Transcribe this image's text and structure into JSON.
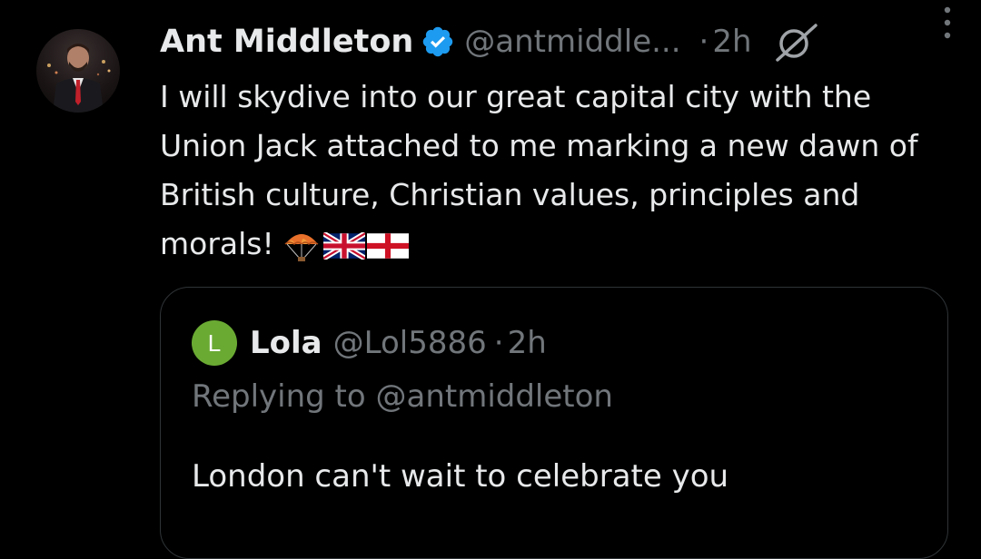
{
  "tweet": {
    "author": {
      "name": "Ant Middleton",
      "handle": "@antmiddle...",
      "avatar_icon": "profile-photo"
    },
    "separator": "·",
    "time": "2h",
    "text": "I will skydive into our great capital city with the Union Jack attached to me marking a new dawn of British culture, Christian values, principles and morals!",
    "emojis": [
      "parachute",
      "uk-flag",
      "england-flag"
    ],
    "colors": {
      "background": "#000000",
      "text": "#e7e9ea",
      "secondary": "#71767b",
      "verified": "#1d9bf0"
    }
  },
  "quote": {
    "author": {
      "avatar_letter": "L",
      "name": "Lola",
      "handle": "@Lol5886"
    },
    "separator": "·",
    "time": "2h",
    "replying_to": "Replying to @antmiddleton",
    "text": "London can't wait to celebrate you",
    "colors": {
      "avatar_bg": "#6aaa33",
      "border": "#2f3336"
    }
  }
}
